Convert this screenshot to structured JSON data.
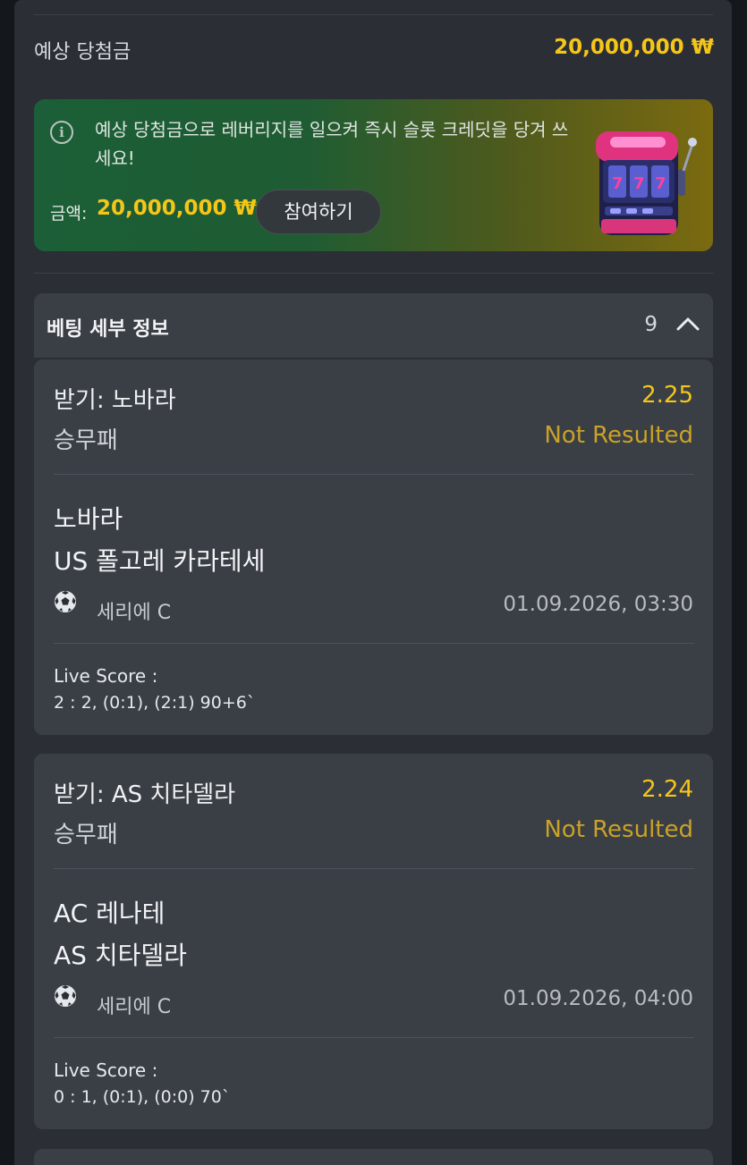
{
  "estimated": {
    "label": "예상 당첨금",
    "value": "20,000,000 ₩"
  },
  "promo": {
    "message": "예상 당첨금으로 레버리지를 일으켜 즉시 슬롯 크레딧을 당겨 쓰세요!",
    "amount_label": "금액:",
    "amount_value": "20,000,000 ₩",
    "join_label": "참여하기",
    "icons": [
      "info-icon",
      "slot-machine-icon"
    ]
  },
  "bet_details": {
    "title": "베팅 세부 정보",
    "count": "9",
    "toggle_icon": "chevron-up-icon"
  },
  "bets": [
    {
      "pick": "받기: 노바라",
      "odds": "2.25",
      "market": "승무패",
      "status": "Not Resulted",
      "home": "노바라",
      "away": "US 폴고레 카라테세",
      "sport_icon": "soccer-ball-icon",
      "league": "세리에 C",
      "datetime": "01.09.2026, 03:30",
      "live_label": "Live Score :",
      "live_value": "2 : 2, (0:1), (2:1) 90+6`"
    },
    {
      "pick": "받기: AS 치타델라",
      "odds": "2.24",
      "market": "승무패",
      "status": "Not Resulted",
      "home": "AC 레나테",
      "away": "AS 치타델라",
      "sport_icon": "soccer-ball-icon",
      "league": "세리에 C",
      "datetime": "01.09.2026, 04:00",
      "live_label": "Live Score :",
      "live_value": "0 : 1, (0:1), (0:0) 70`"
    }
  ],
  "colors": {
    "accent": "#f5c518",
    "status": "#c9a227",
    "panel": "#2b2f35",
    "card": "#3a3e45"
  }
}
